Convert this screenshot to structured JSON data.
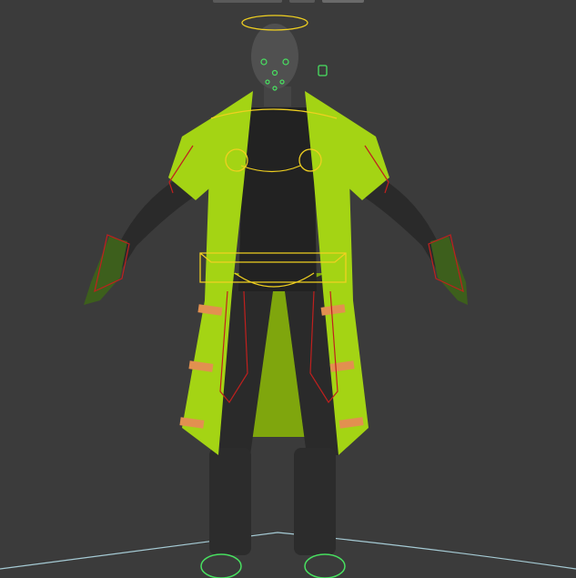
{
  "viewport": {
    "background": "#3b3b3b",
    "grid_color": "#4a4a4a"
  },
  "character": {
    "skin_color": "#505050",
    "suit_color": "#2a2a2a",
    "coat_color": "#a4d414",
    "coat_shadow": "#7fa60d",
    "boot_color": "#2c2c2c",
    "glove_color": "#3d5f1c"
  },
  "rig_colors": {
    "selected_control": "#f0d020",
    "ik_control": "#c0201e",
    "facial_control": "#48e060",
    "strap_control": "#e29050",
    "ground_line": "#b8e4f0"
  },
  "icons": {
    "viewcube": "square-handle-icon"
  }
}
